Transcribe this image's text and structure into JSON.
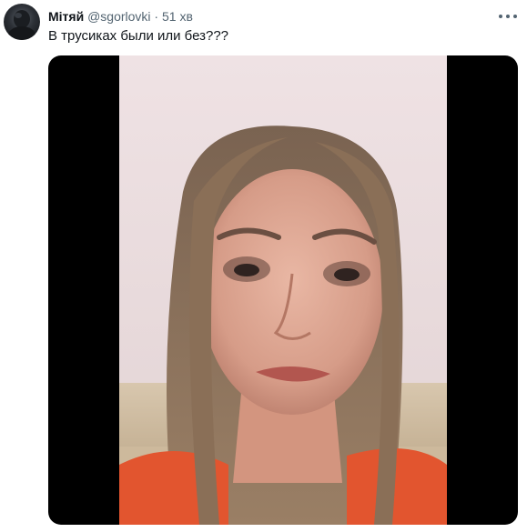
{
  "tweet": {
    "author_name": "Мітяй",
    "author_handle": "@sgorlovki",
    "separator": "·",
    "timestamp": "51 хв",
    "text": "В трусиках были или без???"
  },
  "icons": {
    "avatar": "avatar",
    "more": "more-horizontal-icon"
  },
  "media": {
    "type": "video-frame",
    "description_icon": "video-thumbnail"
  },
  "colors": {
    "text_primary": "#0f1419",
    "text_secondary": "#536471",
    "media_background": "#000000"
  }
}
